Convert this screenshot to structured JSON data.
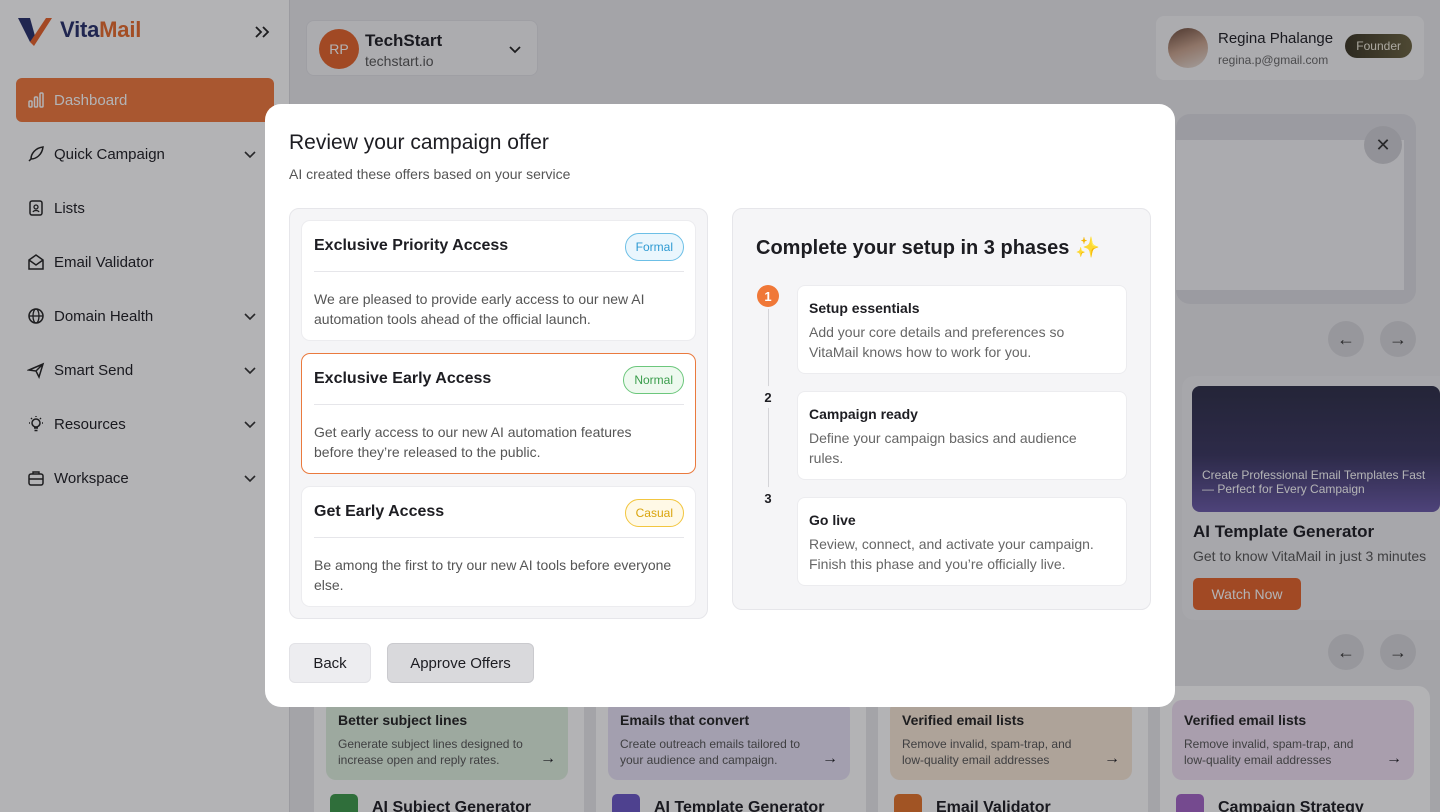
{
  "brand": {
    "name_part1": "Vita",
    "name_part2": "Mail"
  },
  "sidebar": {
    "items": [
      {
        "label": "Dashboard",
        "icon": "bar-chart-icon"
      },
      {
        "label": "Quick Campaign",
        "icon": "rocket-icon"
      },
      {
        "label": "Lists",
        "icon": "contacts-icon"
      },
      {
        "label": "Email Validator",
        "icon": "mail-check-icon"
      },
      {
        "label": "Domain Health",
        "icon": "globe-icon"
      },
      {
        "label": "Smart Send",
        "icon": "send-icon"
      },
      {
        "label": "Resources",
        "icon": "lightbulb-icon"
      },
      {
        "label": "Workspace",
        "icon": "briefcase-icon"
      }
    ]
  },
  "org": {
    "initials": "RP",
    "name": "TechStart",
    "domain": "techstart.io"
  },
  "user": {
    "name": "Regina Phalange",
    "email": "regina.p@gmail.com",
    "role": "Founder"
  },
  "promo": {
    "image_caption": "Create Professional Email Templates Fast — Perfect for Every Campaign",
    "title": "AI Template Generator",
    "subtitle": "Get to know VitaMail in just 3 minutes",
    "cta": "Watch Now"
  },
  "tools": [
    {
      "head_title": "Better subject lines",
      "head_desc": "Generate subject lines designed to increase open and reply rates.",
      "name": "AI Subject Generator",
      "tint": "#dff0df"
    },
    {
      "head_title": "Emails that convert",
      "head_desc": "Create outreach emails tailored to your audience and campaign.",
      "name": "AI Template Generator",
      "tint": "#e7e2f6"
    },
    {
      "head_title": "Verified email lists",
      "head_desc": "Remove invalid, spam-trap, and low-quality email addresses",
      "name": "Email Validator",
      "tint": "#f8e7d6"
    },
    {
      "head_title": "Verified email lists",
      "head_desc": "Remove invalid, spam-trap, and low-quality email addresses",
      "name": "Campaign Strategy",
      "tint": "#f1e1f4"
    }
  ],
  "modal": {
    "title": "Review your campaign offer",
    "subtitle": "AI created these offers based on your service",
    "offers": [
      {
        "title": "Exclusive Priority Access",
        "tag": "Formal",
        "body": "We are pleased to provide early access to our new AI automation tools ahead of the official launch."
      },
      {
        "title": "Exclusive Early Access",
        "tag": "Normal",
        "body": "Get early access to our new AI automation features before they’re released to the public."
      },
      {
        "title": "Get Early Access",
        "tag": "Casual",
        "body": "Be among the first to try our new AI tools before everyone else."
      }
    ],
    "phases_title": "Complete your setup in 3 phases ✨",
    "phases": [
      {
        "num": "1",
        "title": "Setup essentials",
        "desc": "Add your core details and preferences so VitaMail knows how to work for you."
      },
      {
        "num": "2",
        "title": "Campaign ready",
        "desc": "Define your campaign basics and audience rules."
      },
      {
        "num": "3",
        "title": "Go live",
        "desc": "Review, connect, and activate your campaign. Finish this phase and you’re officially live."
      }
    ],
    "back_label": "Back",
    "approve_label": "Approve Offers"
  },
  "colors": {
    "accent": "#f0783c",
    "brand_navy": "#27306b"
  }
}
